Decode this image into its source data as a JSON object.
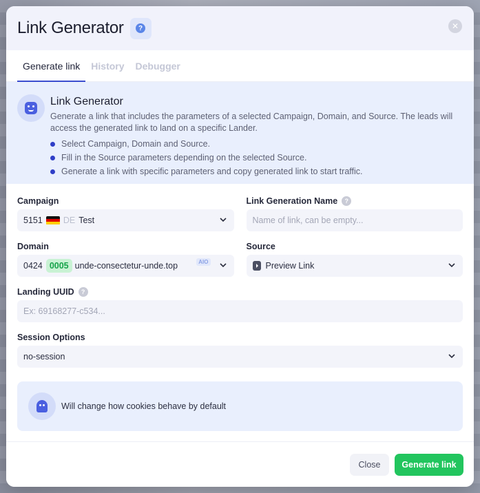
{
  "modal": {
    "title": "Link Generator",
    "help_glyph": "?",
    "close_glyph": "✕"
  },
  "tabs": [
    {
      "label": "Generate link",
      "active": true
    },
    {
      "label": "History",
      "active": false
    },
    {
      "label": "Debugger",
      "active": false
    }
  ],
  "info": {
    "icon": "bot-face-icon",
    "title": "Link Generator",
    "description": "Generate a link that includes the parameters of a selected Campaign, Domain, and Source. The leads will access the generated link to land on a specific Lander.",
    "bullets": [
      "Select Campaign, Domain and Source.",
      "Fill in the Source parameters depending on the selected Source.",
      "Generate a link with specific parameters and copy generated link to start traffic."
    ]
  },
  "form": {
    "campaign": {
      "label": "Campaign",
      "id": "5151",
      "country_code": "DE",
      "name": "Test"
    },
    "link_name": {
      "label": "Link Generation Name",
      "placeholder": "Name of link, can be empty..."
    },
    "domain": {
      "label": "Domain",
      "id": "0424",
      "badge": "0005",
      "name": "unde-consectetur-unde.top",
      "tag": "AIO"
    },
    "source": {
      "label": "Source",
      "value": "Preview Link",
      "icon": "play-box-icon"
    },
    "landing_uuid": {
      "label": "Landing UUID",
      "placeholder": "Ex: 69168277-c534..."
    },
    "session": {
      "label": "Session Options",
      "value": "no-session"
    }
  },
  "notice": {
    "icon": "ghost-icon",
    "text": "Will change how cookies behave by default"
  },
  "footer": {
    "close_label": "Close",
    "generate_label": "Generate link"
  },
  "colors": {
    "accent": "#3b4ccf",
    "primary_button": "#22c55e",
    "info_bg": "#e9effd",
    "badge_green": "#16a34a"
  }
}
